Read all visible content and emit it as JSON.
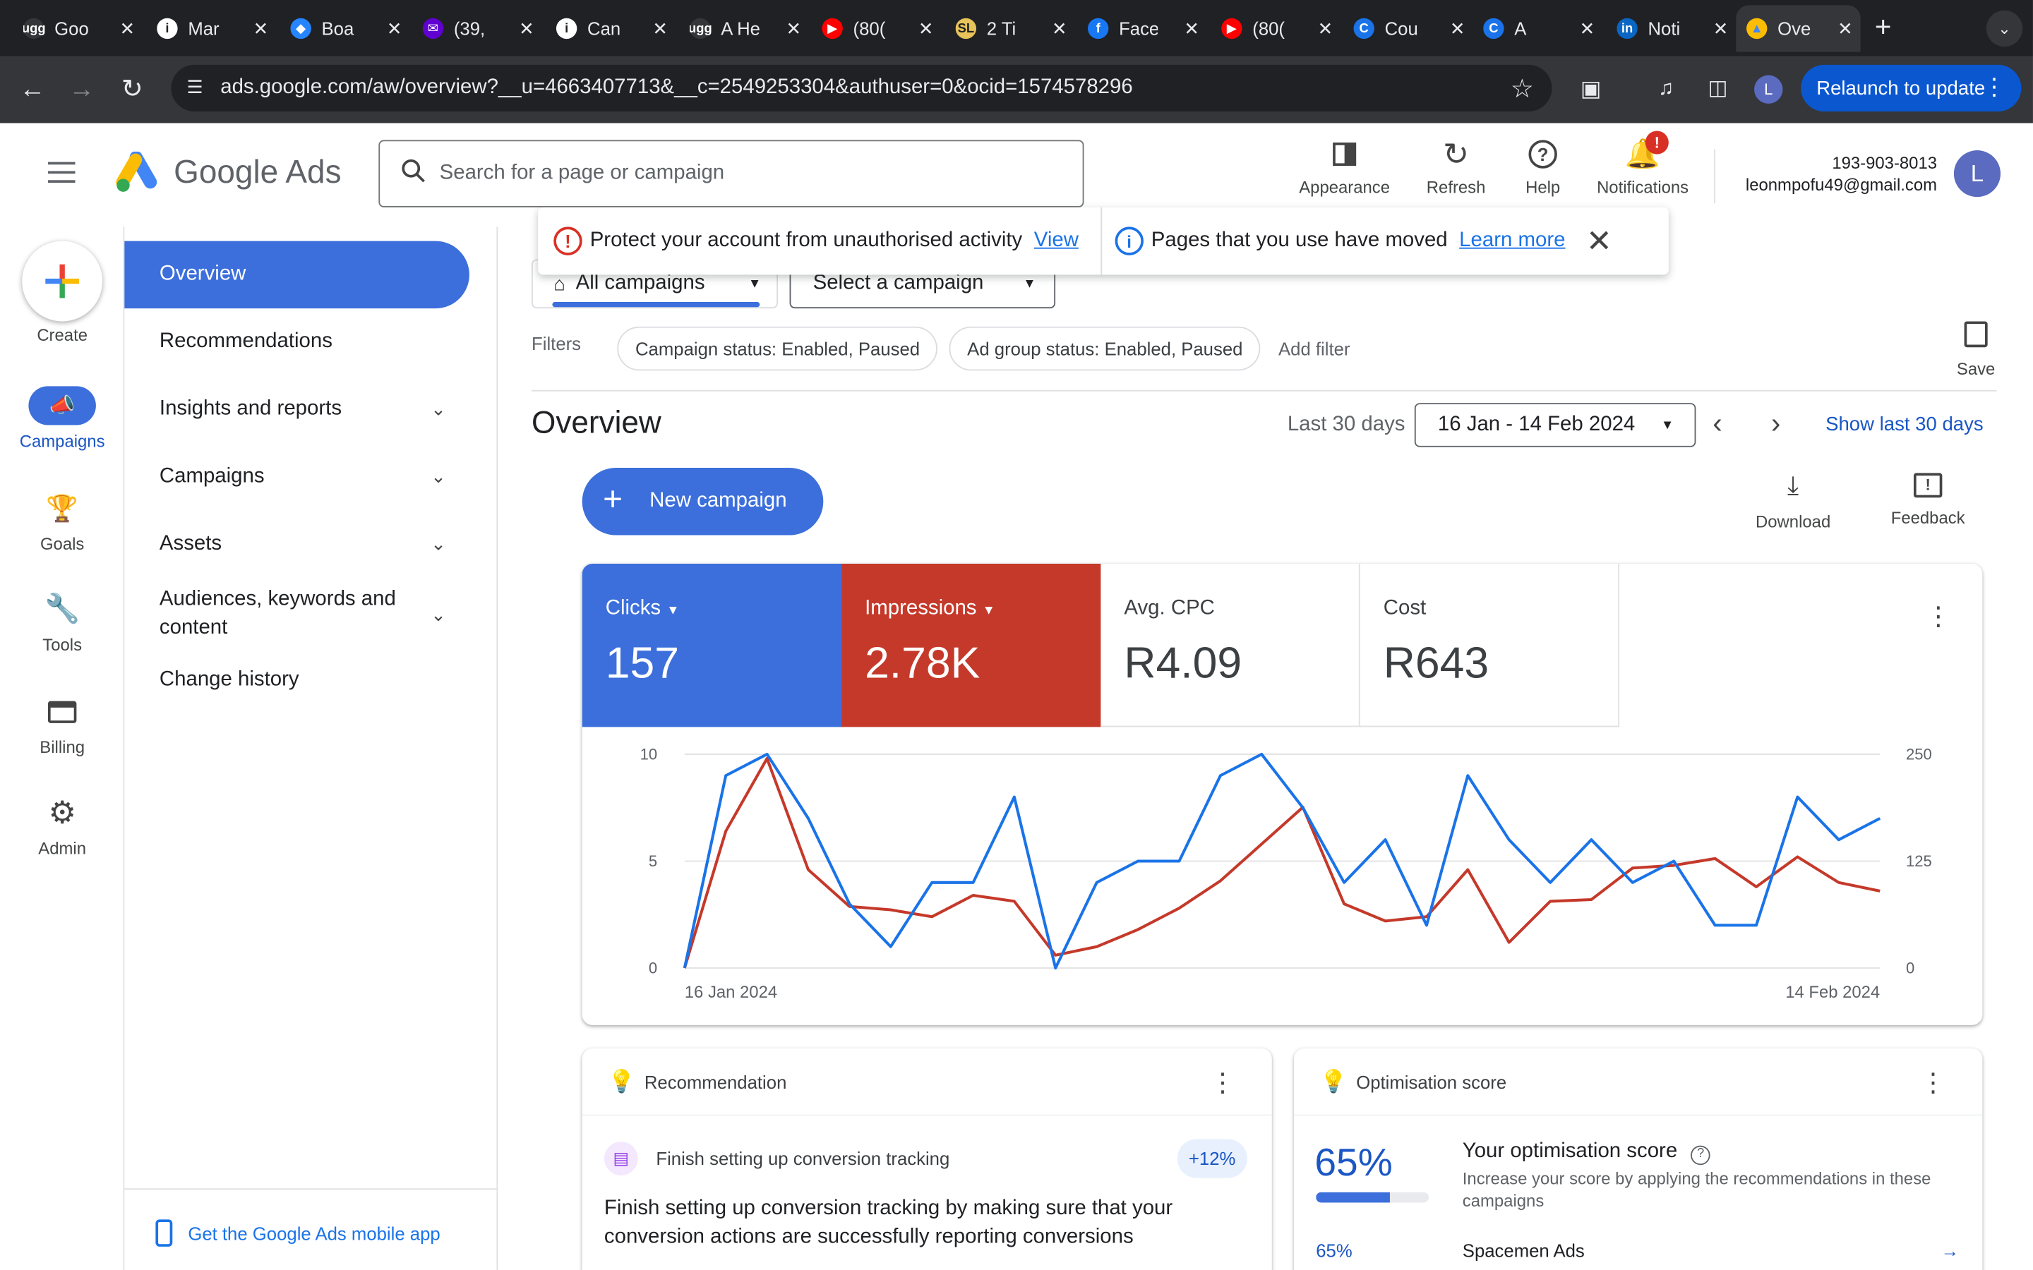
{
  "browser": {
    "tabs": [
      {
        "icon": "ugg-icon",
        "title": "Goo"
      },
      {
        "icon": "info-icon",
        "title": "Mar"
      },
      {
        "icon": "jira-icon",
        "title": "Boa"
      },
      {
        "icon": "mail-icon",
        "title": "(39,"
      },
      {
        "icon": "info-icon",
        "title": "Can"
      },
      {
        "icon": "ugg-icon",
        "title": "A He"
      },
      {
        "icon": "youtube-icon",
        "title": "(80("
      },
      {
        "icon": "sl-icon",
        "title": "2 Ti"
      },
      {
        "icon": "facebook-icon",
        "title": "Face"
      },
      {
        "icon": "youtube-icon",
        "title": "(80("
      },
      {
        "icon": "c-icon",
        "title": "Cou"
      },
      {
        "icon": "c-icon",
        "title": "A"
      },
      {
        "icon": "linkedin-icon",
        "title": "Noti"
      },
      {
        "icon": "google-ads-icon",
        "title": "Ove"
      }
    ],
    "url": "ads.google.com/aw/overview?__u=4663407713&__c=2549253304&authuser=0&ocid=1574578296",
    "relaunch_label": "Relaunch to update",
    "profile_initial": "L"
  },
  "header": {
    "logo_text": "Google Ads",
    "search_placeholder": "Search for a page or campaign",
    "appearance_label": "Appearance",
    "refresh_label": "Refresh",
    "help_label": "Help",
    "notifications_label": "Notifications",
    "notification_badge": "!",
    "account_id": "193-903-8013",
    "account_email": "leonmpofu49@gmail.com",
    "avatar_initial": "L"
  },
  "rail": {
    "create": "Create",
    "campaigns": "Campaigns",
    "goals": "Goals",
    "tools": "Tools",
    "billing": "Billing",
    "admin": "Admin"
  },
  "sidenav": {
    "overview": "Overview",
    "recommendations": "Recommendations",
    "insights": "Insights and reports",
    "campaigns": "Campaigns",
    "assets": "Assets",
    "audiences": "Audiences, keywords and content",
    "change_history": "Change history",
    "mobile_app": "Get the Google Ads mobile app"
  },
  "banner": {
    "protect_text": "Protect your account from unauthorised activity",
    "protect_link": "View",
    "moved_text": "Pages that you use have moved",
    "moved_link": "Learn more"
  },
  "selectors": {
    "all_campaigns": "All campaigns",
    "select_campaign": "Select a campaign"
  },
  "filters": {
    "label": "Filters",
    "chips": [
      "Campaign status: Enabled, Paused",
      "Ad group status: Enabled, Paused"
    ],
    "add_filter": "Add filter",
    "save": "Save"
  },
  "overview": {
    "title": "Overview",
    "range_label": "Last 30 days",
    "date_range": "16 Jan - 14 Feb 2024",
    "show_last": "Show last 30 days",
    "new_campaign": "New campaign",
    "download": "Download",
    "feedback": "Feedback"
  },
  "metrics": [
    {
      "label": "Clicks",
      "value": "157",
      "color": "#3c6fdb"
    },
    {
      "label": "Impressions",
      "value": "2.78K",
      "color": "#c5392a"
    },
    {
      "label": "Avg. CPC",
      "value": "R4.09"
    },
    {
      "label": "Cost",
      "value": "R643"
    }
  ],
  "chart_data": {
    "type": "line",
    "x_start_label": "16 Jan 2024",
    "x_end_label": "14 Feb 2024",
    "y_left_ticks": [
      "10",
      "5",
      "0"
    ],
    "y_right_ticks": [
      "250",
      "125",
      "0"
    ],
    "ylim_left": [
      0,
      10
    ],
    "ylim_right": [
      0,
      250
    ],
    "series": [
      {
        "name": "Clicks",
        "axis": "left",
        "color": "#1a73e8",
        "values": [
          0,
          9,
          10,
          7,
          3,
          1,
          4,
          4,
          8,
          0,
          4,
          5,
          5,
          9,
          10,
          7.5,
          4,
          6,
          2,
          9,
          6,
          4,
          6,
          4,
          5,
          2,
          2,
          8,
          6,
          7
        ]
      },
      {
        "name": "Impressions",
        "axis": "right",
        "color": "#c5392a",
        "values": [
          0,
          160,
          245,
          115,
          72,
          68,
          60,
          85,
          78,
          15,
          25,
          45,
          70,
          102,
          145,
          188,
          75,
          55,
          60,
          115,
          30,
          78,
          80,
          117,
          120,
          128,
          95,
          130,
          100,
          90
        ]
      }
    ]
  },
  "recommendation_card": {
    "title": "Recommendation",
    "item_title": "Finish setting up conversion tracking",
    "uplift": "+12%",
    "body": "Finish setting up conversion tracking by making sure that your conversion actions are successfully reporting conversions"
  },
  "optimisation_card": {
    "title": "Optimisation score",
    "score": "65%",
    "score_fraction": 0.65,
    "heading": "Your optimisation score",
    "desc": "Increase your score by applying the recommendations in these campaigns",
    "row_score": "65%",
    "row_name": "Spacemen Ads"
  }
}
